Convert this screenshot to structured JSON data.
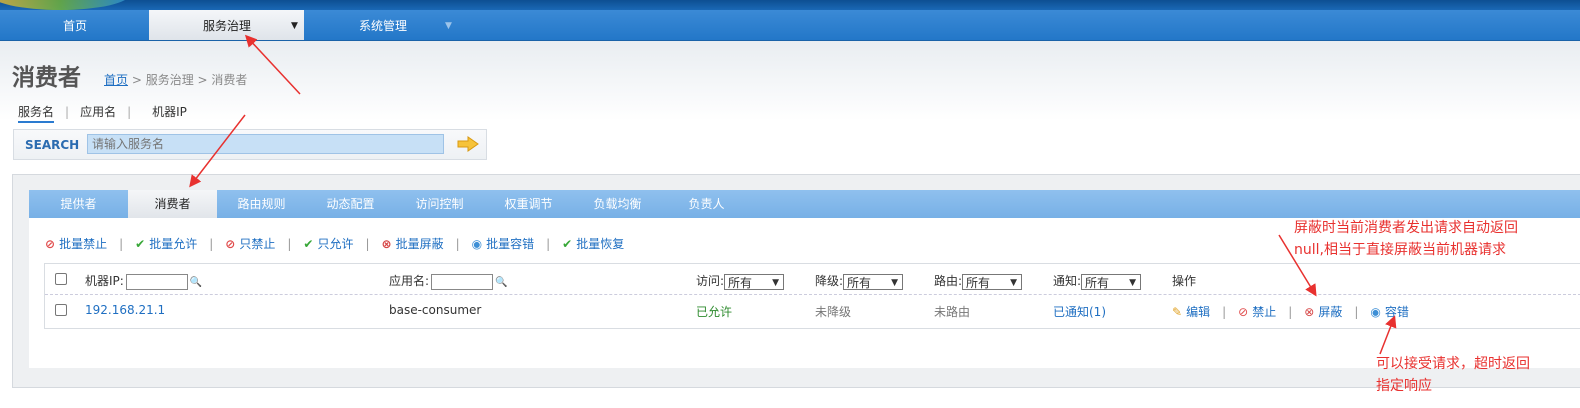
{
  "nav": {
    "home": "首页",
    "service": "服务治理",
    "system": "系统管理"
  },
  "page": {
    "title": "消费者",
    "breadcrumb": {
      "home": "首页",
      "rest": " > 服务治理 > 消费者"
    }
  },
  "subnav": {
    "by_service": "服务名",
    "by_app": "应用名",
    "by_ip": "机器IP",
    "sep": "|"
  },
  "search": {
    "label": "SEARCH",
    "placeholder": "请输入服务名"
  },
  "tabs": [
    "提供者",
    "消费者",
    "路由规则",
    "动态配置",
    "访问控制",
    "权重调节",
    "负载均衡",
    "负责人"
  ],
  "actions": {
    "batch_disable": "批量禁止",
    "batch_allow": "批量允许",
    "only_disable": "只禁止",
    "only_allow": "只允许",
    "batch_shield": "批量屏蔽",
    "batch_tolerant": "批量容错",
    "batch_restore": "批量恢复",
    "sep": "|"
  },
  "table": {
    "headers": {
      "ip": "机器IP:",
      "app": "应用名:",
      "access": "访问:",
      "degrade": "降级:",
      "route": "路由:",
      "notify": "通知:",
      "ops": "操作"
    },
    "filter_default": "所有",
    "row": {
      "ip": "192.168.21.1",
      "app": "base-consumer",
      "access": "已允许",
      "degrade": "未降级",
      "route": "未路由",
      "notify": "已通知(1)",
      "ops": {
        "edit": "编辑",
        "disable": "禁止",
        "shield": "屏蔽",
        "tolerant": "容错"
      }
    }
  },
  "annotations": {
    "shield_note_1": "屏蔽时当前消费者发出请求自动返回",
    "shield_note_2": "null,相当于直接屏蔽当前机器请求",
    "tolerant_note_1": "可以接受请求，超时返回",
    "tolerant_note_2": "指定响应"
  },
  "colors": {
    "nav": "#2377c8",
    "link": "#1f6fc2",
    "annotation": "#e8312f",
    "allowed": "#2e8b2e"
  }
}
